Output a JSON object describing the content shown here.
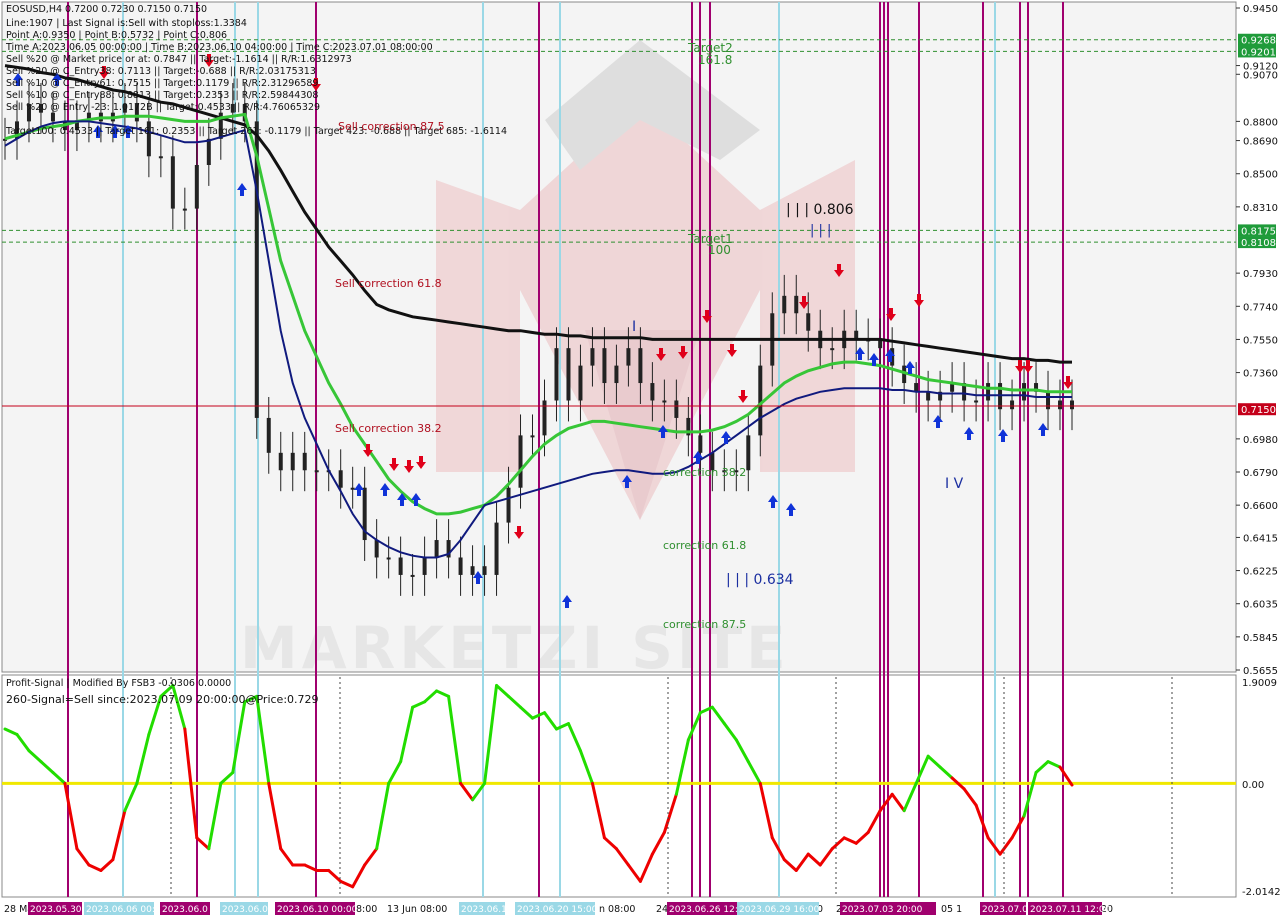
{
  "symbol_header": "EOSUSD,H4  0.7200 0.7230 0.7150 0.7150",
  "info_lines": [
    "Line:1907 | Last Signal is:Sell with stoploss:1.3384",
    "Point A:0.9350 | Point B:0.5732 | Point C:0.806",
    "Time A:2023.06.05 00:00:00 | Time B:2023.06.10 04:00:00 | Time C:2023.07.01 08:00:00",
    "Sell %20 @ Market price or at: 0.7847 || Target:-1.1614 || R/R:1.6312973",
    "Sell %20 @ C_Entry38: 0.7113 || Target:-0.688 || R/R:2.03175313",
    "Sell %10 @ C_Entry61: 0.7515 || Target:0.1179 || R/R:2.31296589",
    "Sell %10 @ C_Entry88: 0.8813 || Target:0.2353 || R/R:2.59844308",
    "Sell %20 @ Entry -23: 1.0172B || Target:0.4533 || R/R:4.76065329",
    "Target100: 0.4533 || Target 161: 0.2353 || Target 261: -0.1179 || Target 423: -0.688 || Target 685: -1.6114"
  ],
  "annotations": {
    "target2": "Target2",
    "target2_level": "161.8",
    "target1": "Target1",
    "target1_level": "100",
    "sell_corr_875": "Sell correction 87.5",
    "sell_corr_618": "Sell correction 61.8",
    "sell_corr_382": "Sell correction 38.2",
    "corr_382": "correction 38.2",
    "corr_618": "correction 61.8",
    "corr_875": "correction 87.5",
    "wave_c_label": "| | | 0.806",
    "wave_c_mark": "| | |",
    "wave_b_label": "| | | 0.634",
    "wave_i": "I",
    "wave_iv": "I V",
    "watermark": "MARKETZI SITE"
  },
  "price_axis": {
    "ticks": [
      "0.9450",
      "0.9120",
      "0.9070",
      "0.8800",
      "0.8690",
      "0.8500",
      "0.8310",
      "0.7930",
      "0.7740",
      "0.7550",
      "0.7360",
      "0.6980",
      "0.6790",
      "0.6600",
      "0.6415",
      "0.6225",
      "0.6035",
      "0.5845",
      "0.5655"
    ],
    "badges": [
      {
        "text": "0.9268",
        "color": "#1f9b3a"
      },
      {
        "text": "0.9201",
        "color": "#1f9b3a"
      },
      {
        "text": "0.8175",
        "color": "#1f9b3a"
      },
      {
        "text": "0.8108",
        "color": "#1f9b3a"
      },
      {
        "text": "0.7150",
        "color": "#c4001a"
      }
    ]
  },
  "indicator": {
    "title": "Profit-Signal | Modified By FSB3 -0.0306 0.0000",
    "signal_text": "260-Signal=Sell since:2023.07.09 20:00:00@Price:0.729",
    "axis_ticks": [
      "1.9009",
      "0.00",
      "-2.0142"
    ]
  },
  "time_axis": {
    "labels": [
      "28 Ma",
      "8:00",
      "13 Jun 08:00",
      "n 08:00",
      "24",
      "0",
      "2",
      "05 1",
      "20"
    ],
    "highlighted": [
      "2023.05.30",
      "2023.06.06 00:00",
      "2023.06.0",
      "2023.06.07",
      "2023.06.10 00:00",
      "2023.06.17",
      "2023.06.20 15:00",
      "2023.06.26 12:00",
      "2023.06.29 16:00",
      "2023.07.03 20:00",
      "2023.07.0",
      "2023.07.11 12:00"
    ]
  },
  "colors": {
    "magenta_line": "#a0006e",
    "cyan_line": "#9ad8e6",
    "black_ma": "#111111",
    "green_ma": "#37c637",
    "navy_ma": "#101a7e",
    "up_arrow": "#1033d8",
    "down_arrow": "#e0001a",
    "osc_up": "#22dd00",
    "osc_down": "#ee0000",
    "zero_line": "#f0e800",
    "target_green": "#2f8f2f"
  },
  "chart_data": {
    "type": "line",
    "title": "EOSUSD,H4",
    "ylim": [
      0.5655,
      0.945
    ],
    "current_price": 0.715,
    "series": [
      {
        "name": "Close",
        "values": [
          0.87,
          0.88,
          0.89,
          0.885,
          0.88,
          0.875,
          0.88,
          0.885,
          0.88,
          0.885,
          0.89,
          0.88,
          0.86,
          0.86,
          0.83,
          0.83,
          0.855,
          0.87,
          0.885,
          0.89,
          0.88,
          0.71,
          0.69,
          0.68,
          0.69,
          0.68,
          0.68,
          0.68,
          0.67,
          0.67,
          0.64,
          0.63,
          0.63,
          0.62,
          0.62,
          0.63,
          0.64,
          0.63,
          0.62,
          0.625,
          0.62,
          0.65,
          0.67,
          0.7,
          0.7,
          0.72,
          0.75,
          0.72,
          0.74,
          0.75,
          0.73,
          0.74,
          0.75,
          0.73,
          0.72,
          0.72,
          0.71,
          0.7,
          0.69,
          0.68,
          0.68,
          0.68,
          0.7,
          0.74,
          0.77,
          0.78,
          0.77,
          0.76,
          0.75,
          0.75,
          0.76,
          0.755,
          0.755,
          0.75,
          0.74,
          0.73,
          0.725,
          0.72,
          0.725,
          0.73,
          0.72,
          0.72,
          0.73,
          0.715,
          0.72,
          0.73,
          0.725,
          0.715,
          0.72,
          0.715
        ]
      },
      {
        "name": "Slow MA",
        "values": [
          0.912,
          0.911,
          0.91,
          0.908,
          0.907,
          0.905,
          0.904,
          0.902,
          0.9,
          0.898,
          0.897,
          0.895,
          0.893,
          0.891,
          0.89,
          0.888,
          0.886,
          0.884,
          0.882,
          0.88,
          0.878,
          0.872,
          0.863,
          0.852,
          0.84,
          0.828,
          0.818,
          0.808,
          0.8,
          0.792,
          0.783,
          0.775,
          0.772,
          0.77,
          0.768,
          0.767,
          0.766,
          0.765,
          0.764,
          0.763,
          0.762,
          0.761,
          0.76,
          0.76,
          0.759,
          0.758,
          0.758,
          0.757,
          0.757,
          0.756,
          0.756,
          0.756,
          0.756,
          0.756,
          0.755,
          0.755,
          0.755,
          0.755,
          0.755,
          0.755,
          0.755,
          0.755,
          0.755,
          0.755,
          0.755,
          0.755,
          0.755,
          0.755,
          0.755,
          0.755,
          0.755,
          0.755,
          0.755,
          0.755,
          0.754,
          0.753,
          0.752,
          0.751,
          0.75,
          0.749,
          0.748,
          0.747,
          0.746,
          0.745,
          0.744,
          0.744,
          0.743,
          0.743,
          0.742,
          0.742
        ]
      },
      {
        "name": "Medium MA",
        "values": [
          0.87,
          0.872,
          0.874,
          0.876,
          0.877,
          0.878,
          0.88,
          0.881,
          0.882,
          0.882,
          0.883,
          0.883,
          0.883,
          0.882,
          0.881,
          0.88,
          0.88,
          0.88,
          0.882,
          0.883,
          0.884,
          0.86,
          0.83,
          0.8,
          0.78,
          0.76,
          0.745,
          0.73,
          0.718,
          0.705,
          0.695,
          0.685,
          0.675,
          0.668,
          0.662,
          0.658,
          0.655,
          0.655,
          0.656,
          0.658,
          0.66,
          0.665,
          0.672,
          0.68,
          0.688,
          0.695,
          0.7,
          0.704,
          0.706,
          0.708,
          0.708,
          0.707,
          0.706,
          0.705,
          0.704,
          0.703,
          0.702,
          0.702,
          0.702,
          0.703,
          0.705,
          0.708,
          0.712,
          0.718,
          0.724,
          0.73,
          0.734,
          0.737,
          0.739,
          0.741,
          0.742,
          0.742,
          0.741,
          0.74,
          0.738,
          0.736,
          0.734,
          0.732,
          0.731,
          0.73,
          0.729,
          0.728,
          0.727,
          0.727,
          0.726,
          0.726,
          0.726,
          0.725,
          0.725,
          0.725
        ]
      },
      {
        "name": "Fast MA",
        "values": [
          0.866,
          0.87,
          0.874,
          0.877,
          0.879,
          0.88,
          0.88,
          0.88,
          0.879,
          0.878,
          0.877,
          0.876,
          0.874,
          0.872,
          0.87,
          0.868,
          0.868,
          0.869,
          0.871,
          0.873,
          0.875,
          0.84,
          0.8,
          0.76,
          0.73,
          0.71,
          0.695,
          0.68,
          0.668,
          0.655,
          0.645,
          0.64,
          0.636,
          0.633,
          0.631,
          0.63,
          0.63,
          0.632,
          0.64,
          0.65,
          0.66,
          0.662,
          0.664,
          0.666,
          0.668,
          0.67,
          0.672,
          0.674,
          0.676,
          0.678,
          0.679,
          0.68,
          0.68,
          0.679,
          0.678,
          0.678,
          0.679,
          0.682,
          0.686,
          0.69,
          0.695,
          0.7,
          0.705,
          0.71,
          0.714,
          0.718,
          0.721,
          0.723,
          0.725,
          0.726,
          0.727,
          0.727,
          0.727,
          0.727,
          0.726,
          0.726,
          0.725,
          0.725,
          0.724,
          0.724,
          0.724,
          0.723,
          0.723,
          0.723,
          0.723,
          0.723,
          0.722,
          0.722,
          0.722,
          0.722
        ]
      }
    ],
    "oscillator": {
      "ylim": [
        -2.0142,
        1.9009
      ],
      "values": [
        1.0,
        0.9,
        0.6,
        0.4,
        0.2,
        0.0,
        -1.2,
        -1.5,
        -1.6,
        -1.4,
        -0.5,
        0.0,
        0.9,
        1.6,
        1.8,
        1.0,
        -1.0,
        -1.2,
        0.0,
        0.2,
        1.5,
        1.6,
        0.0,
        -1.2,
        -1.5,
        -1.5,
        -1.6,
        -1.6,
        -1.8,
        -1.9,
        -1.5,
        -1.2,
        0.0,
        0.4,
        1.4,
        1.5,
        1.7,
        1.6,
        0.0,
        -0.3,
        0.0,
        1.8,
        1.6,
        1.4,
        1.2,
        1.3,
        1.0,
        1.1,
        0.6,
        0.0,
        -1.0,
        -1.2,
        -1.5,
        -1.8,
        -1.3,
        -0.9,
        -0.2,
        0.8,
        1.3,
        1.4,
        1.1,
        0.8,
        0.4,
        0.0,
        -1.0,
        -1.4,
        -1.6,
        -1.3,
        -1.5,
        -1.2,
        -1.0,
        -1.1,
        -0.9,
        -0.5,
        -0.2,
        -0.5,
        0.0,
        0.5,
        0.3,
        0.1,
        -0.1,
        -0.4,
        -1.0,
        -1.3,
        -1.0,
        -0.6,
        0.2,
        0.4,
        0.3,
        -0.03
      ]
    }
  }
}
